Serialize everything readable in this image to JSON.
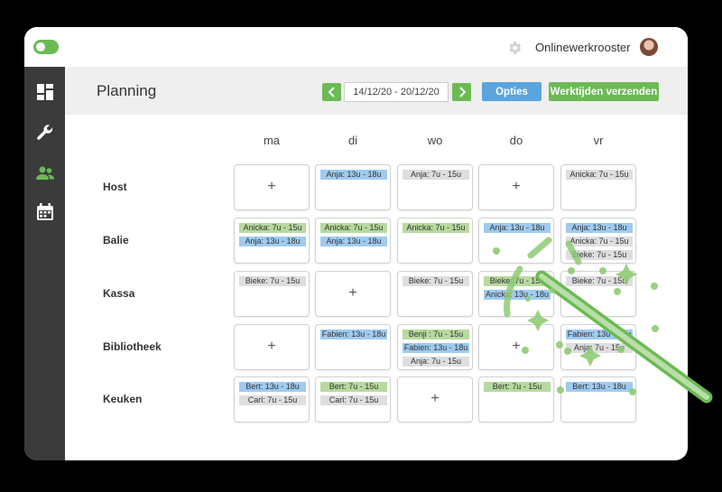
{
  "header": {
    "brand": "Onlinewerkrooster"
  },
  "page": {
    "title": "Planning"
  },
  "toolbar": {
    "date_range": "14/12/20 - 20/12/20",
    "options_label": "Opties",
    "send_label": "Werktijden verzenden"
  },
  "days": [
    "ma",
    "di",
    "wo",
    "do",
    "vr"
  ],
  "rows": [
    {
      "label": "Host",
      "cells": [
        {
          "shifts": []
        },
        {
          "shifts": [
            {
              "text": "Anja: 13u - 18u",
              "color": "blue"
            }
          ]
        },
        {
          "shifts": [
            {
              "text": "Anja: 7u - 15u",
              "color": "grey"
            }
          ]
        },
        {
          "shifts": []
        },
        {
          "shifts": [
            {
              "text": "Anicka: 7u - 15u",
              "color": "grey"
            }
          ]
        }
      ]
    },
    {
      "label": "Balie",
      "cells": [
        {
          "shifts": [
            {
              "text": "Anicka: 7u - 15u",
              "color": "green"
            },
            {
              "text": "Anja: 13u - 18u",
              "color": "blue"
            }
          ]
        },
        {
          "shifts": [
            {
              "text": "Anicka: 7u - 15u",
              "color": "green"
            },
            {
              "text": "Anja: 13u - 18u",
              "color": "blue"
            }
          ]
        },
        {
          "shifts": [
            {
              "text": "Anicka: 7u - 15u",
              "color": "green"
            }
          ]
        },
        {
          "shifts": [
            {
              "text": "Anja: 13u - 18u",
              "color": "blue"
            }
          ]
        },
        {
          "shifts": [
            {
              "text": "Anja: 13u - 18u",
              "color": "blue"
            },
            {
              "text": "Anicka: 7u - 15u",
              "color": "grey"
            },
            {
              "text": "Bieke: 7u - 15u",
              "color": "grey"
            }
          ]
        }
      ]
    },
    {
      "label": "Kassa",
      "cells": [
        {
          "shifts": [
            {
              "text": "Bieke: 7u - 15u",
              "color": "grey"
            }
          ]
        },
        {
          "shifts": []
        },
        {
          "shifts": [
            {
              "text": "Bieke: 7u - 15u",
              "color": "grey"
            }
          ]
        },
        {
          "shifts": [
            {
              "text": "Bieke: 7u - 15u",
              "color": "green"
            },
            {
              "text": "Anicka: 13u - 18u",
              "color": "blue"
            }
          ]
        },
        {
          "shifts": [
            {
              "text": "Bieke: 7u - 15u",
              "color": "grey"
            }
          ]
        }
      ]
    },
    {
      "label": "Bibliotheek",
      "cells": [
        {
          "shifts": []
        },
        {
          "shifts": [
            {
              "text": "Fabien: 13u - 18u",
              "color": "blue"
            }
          ]
        },
        {
          "shifts": [
            {
              "text": "Benji : 7u - 15u",
              "color": "green"
            },
            {
              "text": "Fabien: 13u - 18u",
              "color": "blue"
            },
            {
              "text": "Anja: 7u - 15u",
              "color": "grey"
            }
          ]
        },
        {
          "shifts": []
        },
        {
          "shifts": [
            {
              "text": "Fabien: 13u - 18u",
              "color": "blue"
            },
            {
              "text": "Anja: 7u - 15u",
              "color": "grey"
            }
          ]
        }
      ]
    },
    {
      "label": "Keuken",
      "cells": [
        {
          "shifts": [
            {
              "text": "Bert: 13u - 18u",
              "color": "blue"
            },
            {
              "text": "Carl: 7u - 15u",
              "color": "grey"
            }
          ]
        },
        {
          "shifts": [
            {
              "text": "Bert: 7u - 15u",
              "color": "green"
            },
            {
              "text": "Carl: 7u - 15u",
              "color": "grey"
            }
          ]
        },
        {
          "shifts": []
        },
        {
          "shifts": [
            {
              "text": "Bert: 7u - 15u",
              "color": "green"
            }
          ]
        },
        {
          "shifts": [
            {
              "text": "Bert: 13u - 18u",
              "color": "blue"
            }
          ]
        }
      ]
    }
  ],
  "empty_cell_symbol": "+",
  "icons": {
    "toggle": "toggle-icon",
    "settings": "gear-icon",
    "sidebar": [
      "dashboard-icon",
      "wrench-icon",
      "users-icon",
      "calendar-icon"
    ],
    "prev": "chevron-left-icon",
    "next": "chevron-right-icon",
    "decoration": "magic-wand-icon"
  },
  "colors": {
    "green": "#6cba54",
    "blue": "#5aa4e0",
    "sidebar": "#3b3b3b",
    "header_bg": "#efefef",
    "shift_green": "#b7da9f",
    "shift_blue": "#9fcbf0",
    "shift_grey": "#dedede"
  }
}
